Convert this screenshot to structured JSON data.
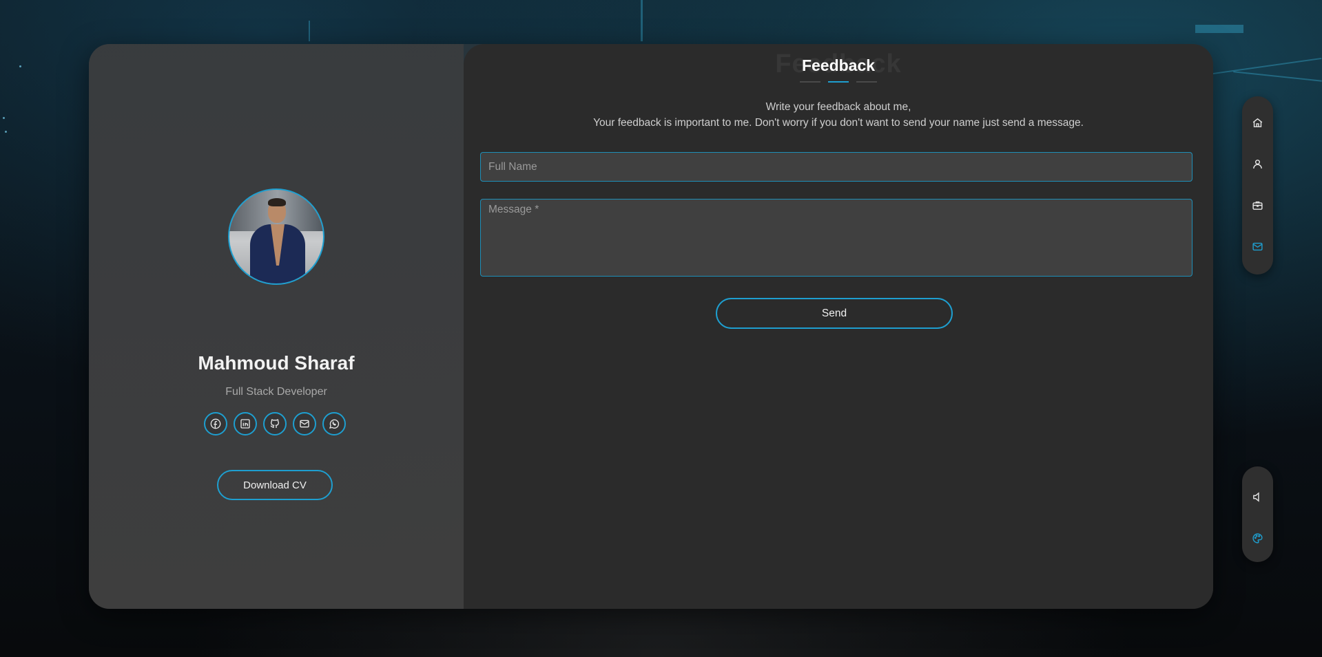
{
  "profile": {
    "name": "Mahmoud Sharaf",
    "role": "Full Stack Developer",
    "socials": [
      {
        "icon": "facebook-icon"
      },
      {
        "icon": "linkedin-icon"
      },
      {
        "icon": "github-icon"
      },
      {
        "icon": "mail-icon"
      },
      {
        "icon": "whatsapp-icon"
      }
    ],
    "download_label": "Download CV"
  },
  "feedback": {
    "title": "Feedback",
    "ghost_title": "Feedback",
    "description_line1": "Write your feedback about me,",
    "description_line2": "Your feedback is important to me. Don't worry if you don't want to send your name just send a message.",
    "name_placeholder": "Full Name",
    "name_value": "",
    "message_placeholder": "Message *",
    "message_value": "",
    "send_label": "Send"
  },
  "nav": {
    "top_items": [
      {
        "icon": "home-icon",
        "active": false
      },
      {
        "icon": "user-icon",
        "active": false
      },
      {
        "icon": "briefcase-icon",
        "active": false
      },
      {
        "icon": "mail-icon",
        "active": true
      }
    ],
    "bottom_items": [
      {
        "icon": "speaker-icon",
        "active": false
      },
      {
        "icon": "palette-icon",
        "active": true
      }
    ]
  },
  "colors": {
    "accent": "#1e9fd0",
    "panel": "#2b2b2b",
    "profile": "#3c3c3c"
  }
}
